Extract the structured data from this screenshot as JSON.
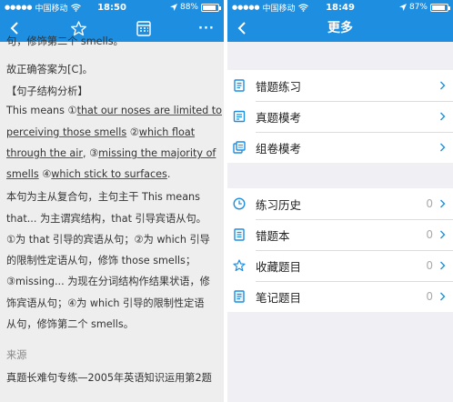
{
  "left_status": {
    "carrier": "中国移动",
    "time": "18:50",
    "battery": "88%",
    "battery_level": 0.88
  },
  "right_status": {
    "carrier": "中国移动",
    "time": "18:49",
    "battery": "87%",
    "battery_level": 0.87
  },
  "left_nav": {
    "back": "back-icon",
    "star": "star-icon",
    "sheet": "answer-sheet-icon",
    "more": "···"
  },
  "right_nav": {
    "title": "更多"
  },
  "article": {
    "line0": "句，修饰第二个 smells。",
    "line1": "故正确答案为[C]。",
    "heading": "【句子结构分析】",
    "l3a": "This means ①",
    "l3b": "that our noses are limited to",
    "l4a": "perceiving those smells",
    "l4b": " ②",
    "l4c": "which float",
    "l5a": "through the air",
    "l5b": ", ③",
    "l5c": "missing the majority of",
    "l6a": "smells",
    "l6b": " ④",
    "l6c": "which stick to surfaces",
    "l6d": ".",
    "p1": "本句为主从复合句，主句主干 This means",
    "p2": "that... 为主谓宾结构，that 引导宾语从句。",
    "p3": "①为 that 引导的宾语从句；②为 which 引导",
    "p4": "的限制性定语从句，修饰 those smells；",
    "p5": "③missing... 为现在分词结构作结果状语，修",
    "p6": "饰宾语从句；④为 which 引导的限制性定语",
    "p7": "从句，修饰第二个 smells。",
    "source_label": "来源",
    "source_text": "真题长难句专练—2005年英语知识运用第2题"
  },
  "menu_group1": [
    {
      "label": "错题练习",
      "icon": "wrong-practice-icon"
    },
    {
      "label": "真题模考",
      "icon": "real-exam-icon"
    },
    {
      "label": "组卷模考",
      "icon": "compose-exam-icon"
    }
  ],
  "menu_group2": [
    {
      "label": "练习历史",
      "count": "0",
      "icon": "clock-icon"
    },
    {
      "label": "错题本",
      "count": "0",
      "icon": "notebook-icon"
    },
    {
      "label": "收藏题目",
      "count": "0",
      "icon": "star-icon"
    },
    {
      "label": "笔记题目",
      "count": "0",
      "icon": "note-icon"
    }
  ],
  "colors": {
    "accent": "#1e8fe0",
    "icon_blue": "#1e8fe0"
  }
}
